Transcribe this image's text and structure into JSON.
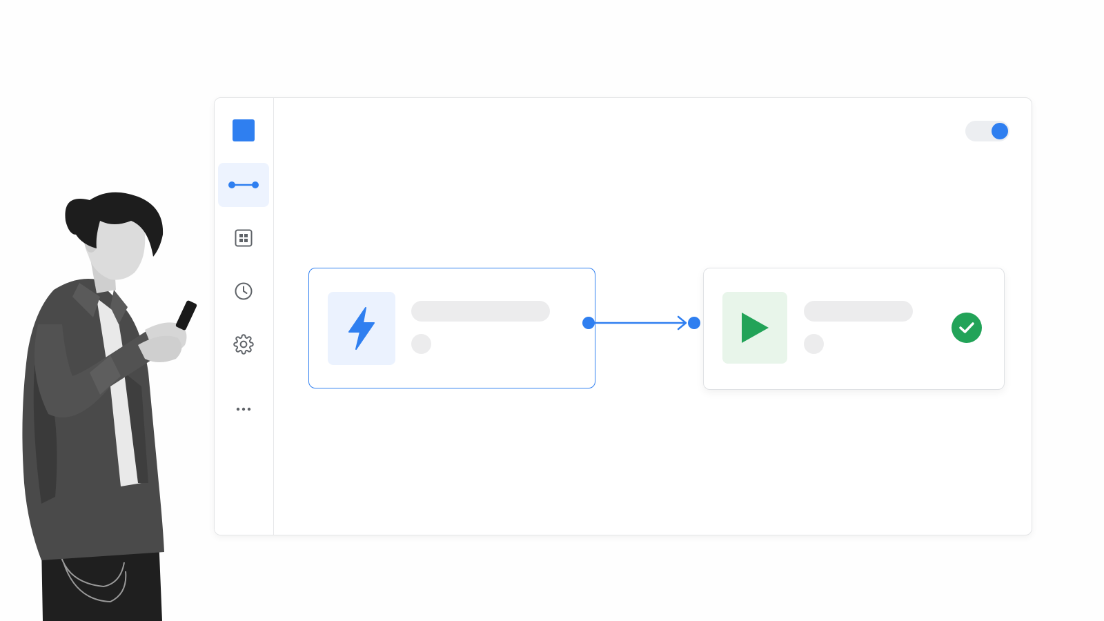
{
  "colors": {
    "accent": "#2f7ff0",
    "accent_soft": "#edf3fe",
    "success": "#22a358",
    "success_soft": "#e8f5ea",
    "skeleton": "#ececed",
    "border": "#e3e4e6"
  },
  "sidebar": {
    "logo": "app-logo",
    "items": [
      {
        "icon": "workflow-icon",
        "active": true
      },
      {
        "icon": "grid-icon",
        "active": false
      },
      {
        "icon": "clock-icon",
        "active": false
      },
      {
        "icon": "gear-icon",
        "active": false
      },
      {
        "icon": "more-icon",
        "active": false
      }
    ]
  },
  "header": {
    "toggle": {
      "icon": "toggle",
      "on": true
    }
  },
  "flow": {
    "trigger": {
      "icon": "lightning-icon",
      "selected": true
    },
    "action": {
      "icon": "play-icon",
      "status_icon": "check-icon",
      "status": "success"
    },
    "connector": {
      "icon": "arrow-icon"
    }
  }
}
